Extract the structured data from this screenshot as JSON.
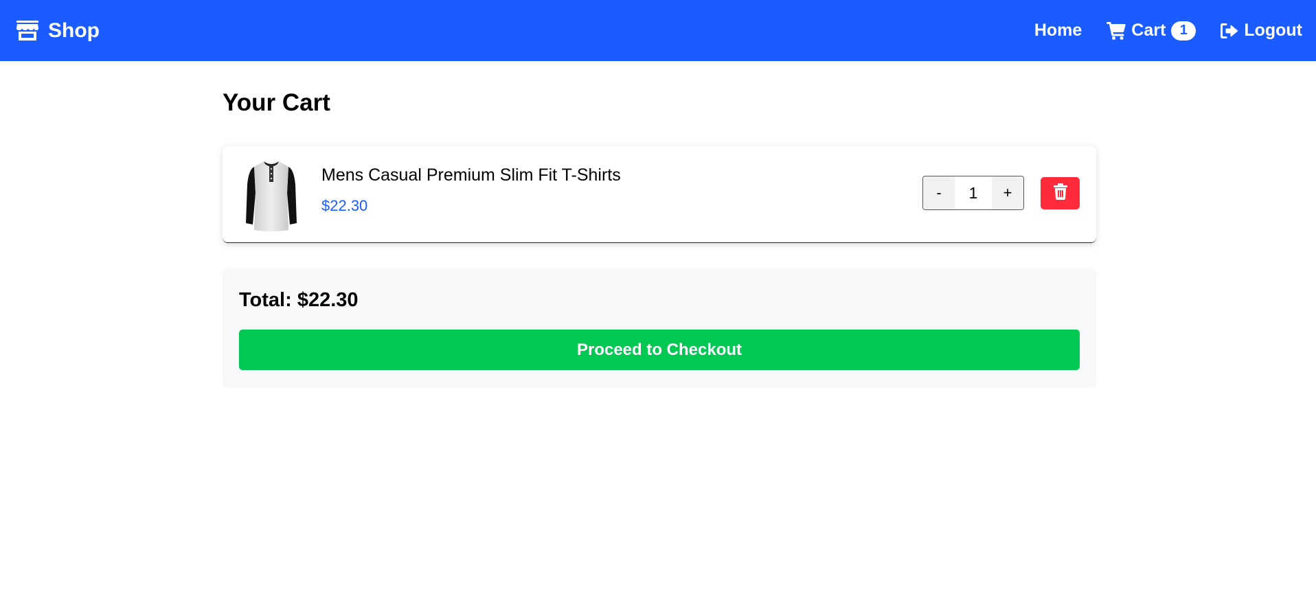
{
  "navbar": {
    "brand_label": "Shop",
    "brand_icon": "store-icon",
    "background_color": "#1a5cff",
    "links": {
      "home_label": "Home",
      "cart_label": "Cart",
      "cart_icon": "cart-icon",
      "cart_count": "1",
      "logout_label": "Logout",
      "logout_icon": "logout-icon"
    }
  },
  "page": {
    "title": "Your Cart"
  },
  "cart": {
    "items": [
      {
        "name": "Mens Casual Premium Slim Fit T-Shirts",
        "price": "$22.30",
        "quantity": "1",
        "decrement_label": "-",
        "increment_label": "+",
        "image_icon": "tshirt-image",
        "delete_icon": "trash-icon"
      }
    ]
  },
  "summary": {
    "total_label": "Total:",
    "total_value": "$22.30",
    "checkout_label": "Proceed to Checkout"
  },
  "colors": {
    "accent": "#1a5cff",
    "price": "#1a5cff",
    "delete": "#ff2b3a",
    "checkout": "#00c853"
  }
}
